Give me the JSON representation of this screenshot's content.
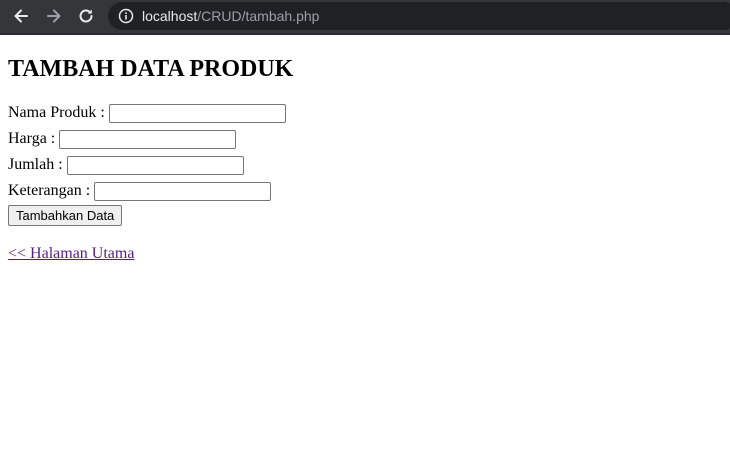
{
  "browser": {
    "url_host": "localhost",
    "url_path": "/CRUD/tambah.php",
    "icons": {
      "back": "arrow-left-icon",
      "forward": "arrow-right-icon",
      "reload": "reload-icon",
      "info": "info-icon"
    },
    "colors": {
      "toolbar": "#35363a",
      "omnibox": "#202124"
    }
  },
  "page": {
    "title": "TAMBAH DATA PRODUK",
    "form": {
      "fields": [
        {
          "label": "Nama Produk :",
          "value": ""
        },
        {
          "label": "Harga :",
          "value": ""
        },
        {
          "label": "Jumlah :",
          "value": ""
        },
        {
          "label": "Keterangan :",
          "value": ""
        }
      ],
      "submit_label": "Tambahkan Data"
    },
    "back_link_label": "<< Halaman Utama",
    "colors": {
      "visited_link": "#551a8b"
    }
  }
}
